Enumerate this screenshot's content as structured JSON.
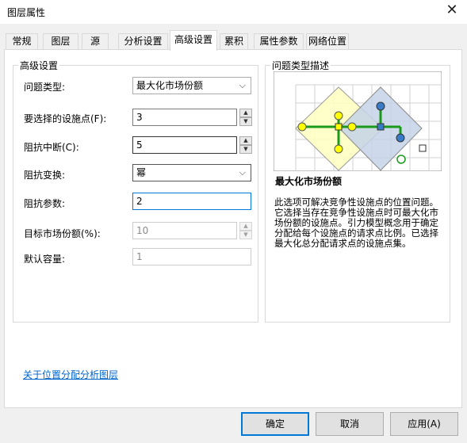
{
  "window": {
    "title": "图层属性",
    "close_glyph": "✕"
  },
  "tabs": [
    {
      "label": "常规"
    },
    {
      "label": "图层"
    },
    {
      "label": "源"
    },
    {
      "label": "分析设置"
    },
    {
      "label": "高级设置",
      "active": true
    },
    {
      "label": "累积"
    },
    {
      "label": "属性参数"
    },
    {
      "label": "网络位置"
    }
  ],
  "advanced": {
    "group_title": "高级设置",
    "problem_type": {
      "label": "问题类型:",
      "value": "最大化市场份额"
    },
    "facilities": {
      "label": "要选择的设施点(F):",
      "value": "3"
    },
    "impedance_cutoff": {
      "label": "阻抗中断(C):",
      "value": "5"
    },
    "impedance_transform": {
      "label": "阻抗变换:",
      "value": "幂"
    },
    "impedance_param": {
      "label": "阻抗参数:",
      "value": "2"
    },
    "target_share": {
      "label": "目标市场份额(%):",
      "value": "10"
    },
    "default_capacity": {
      "label": "默认容量:",
      "value": "1"
    }
  },
  "description": {
    "group_title": "问题类型描述",
    "heading": "最大化市场份额",
    "text": "此选项可解决竞争性设施点的位置问题。它选择当存在竞争性设施点时可最大化市场份额的设施点。引力模型概念用于确定分配给每个设施点的请求点比例。已选择最大化总分配请求点的设施点集。"
  },
  "link_text": "关于位置分配分析图层",
  "buttons": {
    "ok": "确定",
    "cancel": "取消",
    "apply": "应用(A)"
  },
  "colors": {
    "accent": "#0078d7",
    "link": "#0066cc",
    "yellow_zone": "#ffffc0",
    "blue_zone": "#c5d4e8",
    "green_route": "#1a9a1a",
    "yellow_point": "#ffff00",
    "blue_point": "#3a7bc8"
  }
}
